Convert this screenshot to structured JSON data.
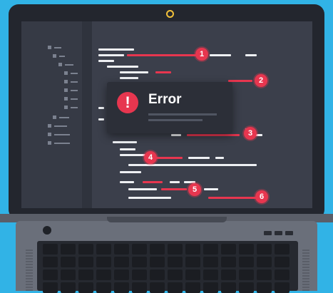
{
  "error_dialog": {
    "title": "Error",
    "icon_glyph": "!"
  },
  "markers": [
    "1",
    "2",
    "3",
    "4",
    "5",
    "6"
  ],
  "colors": {
    "background": "#31b3e6",
    "accent_red": "#e7364f",
    "bezel": "#23262e",
    "screen": "#3b3f4b",
    "camera_ring": "#f2c13a"
  }
}
